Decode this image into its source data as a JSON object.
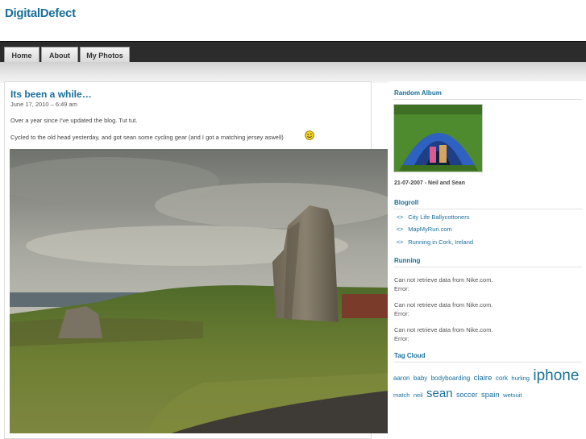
{
  "site": {
    "title": "DigitalDefect"
  },
  "nav": {
    "items": [
      "Home",
      "About",
      "My Photos"
    ]
  },
  "post": {
    "title": "Its been a while…",
    "date": "June 17, 2010 – 6:49 am",
    "paragraphs": [
      "Over a year since I've updated the blog. Tut tut.",
      "Cycled to the old head yesterday, and got sean some cycling gear (and I got a matching jersey aswell)"
    ]
  },
  "sidebar": {
    "random_album": {
      "heading": "Random Album",
      "caption": "21-07-2007 - Neil and Sean"
    },
    "blogroll": {
      "heading": "Blogroll",
      "links": [
        "City Life Ballycottoners",
        "MapMyRun.com",
        "Running in Cork, Ireland"
      ]
    },
    "running": {
      "heading": "Running",
      "messages": [
        {
          "line1": "Can not retrieve data from Nike.com.",
          "line2": "Error:"
        },
        {
          "line1": "Can not retrieve data from Nike.com.",
          "line2": "Error:"
        },
        {
          "line1": "Can not retrieve data from Nike.com.",
          "line2": "Error:"
        }
      ]
    },
    "tag_cloud": {
      "heading": "Tag Cloud",
      "tags": [
        {
          "name": "aaron",
          "size": 8
        },
        {
          "name": "baby",
          "size": 8
        },
        {
          "name": "bodyboarding",
          "size": 8
        },
        {
          "name": "claire",
          "size": 9.5
        },
        {
          "name": "cork",
          "size": 8
        },
        {
          "name": "hurling",
          "size": 7.5
        },
        {
          "name": "iphone",
          "size": 19
        },
        {
          "name": "match",
          "size": 7.5
        },
        {
          "name": "neil",
          "size": 7.5
        },
        {
          "name": "sean",
          "size": 15
        },
        {
          "name": "soccer",
          "size": 9
        },
        {
          "name": "spain",
          "size": 9.5
        },
        {
          "name": "wetsuit",
          "size": 7.5
        }
      ]
    }
  },
  "colors": {
    "accent": "#1a6f9b",
    "navbar": "#2c2c2c"
  }
}
